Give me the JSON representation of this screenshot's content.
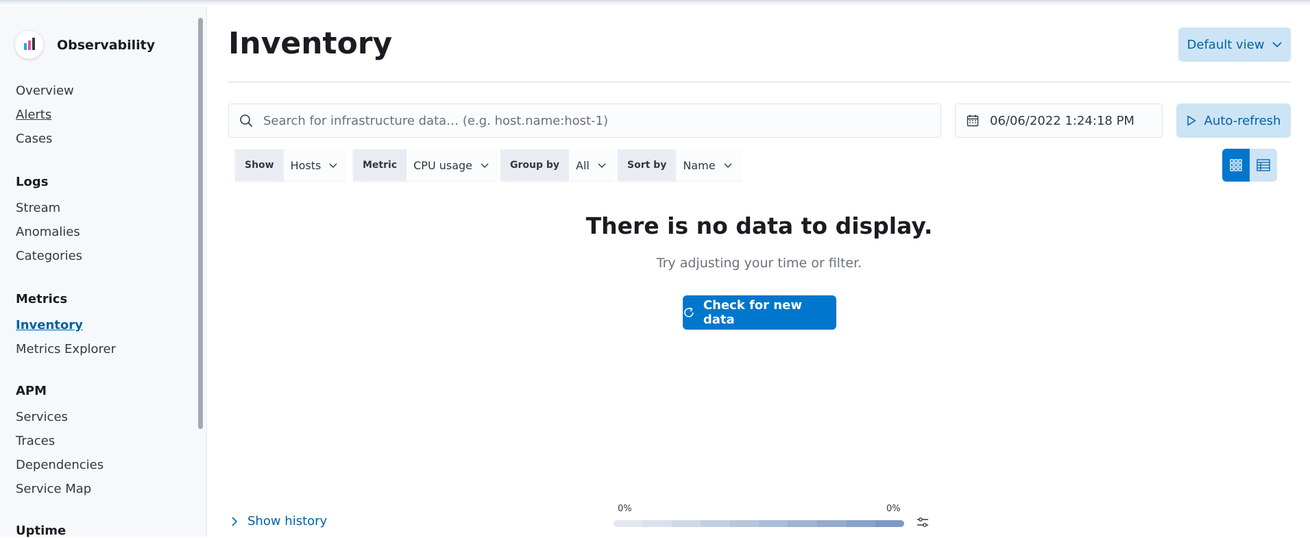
{
  "sidebar": {
    "brand": "Observability",
    "nav": {
      "overview": "Overview",
      "alerts": "Alerts",
      "cases": "Cases",
      "logs_heading": "Logs",
      "stream": "Stream",
      "anomalies": "Anomalies",
      "categories": "Categories",
      "metrics_heading": "Metrics",
      "inventory": "Inventory",
      "metrics_explorer": "Metrics Explorer",
      "apm_heading": "APM",
      "services": "Services",
      "traces": "Traces",
      "dependencies": "Dependencies",
      "service_map": "Service Map",
      "uptime_heading": "Uptime"
    }
  },
  "header": {
    "title": "Inventory",
    "view_button": "Default view"
  },
  "toolbar": {
    "search_placeholder": "Search for infrastructure data… (e.g. host.name:host-1)",
    "date": "06/06/2022 1:24:18 PM",
    "autorefresh": "Auto-refresh"
  },
  "filters": {
    "show": {
      "label": "Show",
      "value": "Hosts"
    },
    "metric": {
      "label": "Metric",
      "value": "CPU usage"
    },
    "group_by": {
      "label": "Group by",
      "value": "All"
    },
    "sort_by": {
      "label": "Sort by",
      "value": "Name"
    }
  },
  "empty_state": {
    "title": "There is no data to display.",
    "subtitle": "Try adjusting your time or filter.",
    "button": "Check for new data"
  },
  "footer": {
    "show_history": "Show history",
    "legend_min": "0%",
    "legend_max": "0%"
  },
  "colors": {
    "accent": "#0077cc",
    "link": "#0061a6",
    "legend": [
      "#e4e9f1",
      "#d9e1ec",
      "#cdd8e7",
      "#c2cfe2",
      "#b6c6dc",
      "#abbdd7",
      "#9fb4d2",
      "#94abcd",
      "#88a2c8",
      "#7d99c3"
    ]
  }
}
